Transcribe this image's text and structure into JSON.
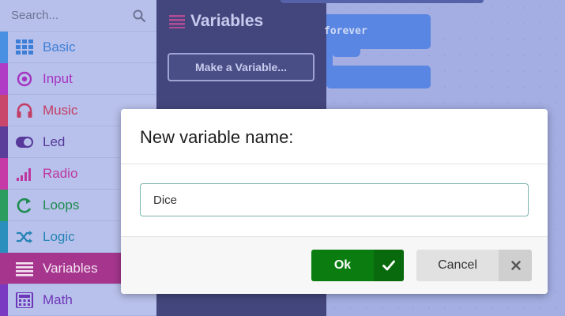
{
  "search": {
    "placeholder": "Search..."
  },
  "categories": [
    {
      "label": "Basic",
      "icon": "grid-icon",
      "color": "#1e90ff",
      "selected": false
    },
    {
      "label": "Input",
      "icon": "target-circle-icon",
      "color": "#c030d0",
      "selected": false
    },
    {
      "label": "Music",
      "icon": "headphones-icon",
      "color": "#d83b6e",
      "selected": false
    },
    {
      "label": "Led",
      "icon": "toggle-icon",
      "color": "#5c2d91",
      "selected": false
    },
    {
      "label": "Radio",
      "icon": "signal-bars-icon",
      "color": "#e3008c",
      "selected": false
    },
    {
      "label": "Loops",
      "icon": "loop-arrow-icon",
      "color": "#00aa00",
      "selected": false
    },
    {
      "label": "Logic",
      "icon": "shuffle-icon",
      "color": "#00a4a6",
      "selected": false
    },
    {
      "label": "Variables",
      "icon": "lines-icon",
      "color": "#dc143c",
      "selected": true
    },
    {
      "label": "Math",
      "icon": "calculator-icon",
      "color": "#9400d3",
      "selected": false
    }
  ],
  "flyout": {
    "title": "Variables",
    "make_variable_label": "Make a Variable..."
  },
  "workspace": {
    "forever_label": "forever"
  },
  "dialog": {
    "title": "New variable name:",
    "input_value": "Dice",
    "ok_label": "Ok",
    "cancel_label": "Cancel"
  },
  "colors": {
    "ok_green": "#0a7c10",
    "variables_magenta": "#a6358e",
    "flyout_bg": "#43467c"
  }
}
